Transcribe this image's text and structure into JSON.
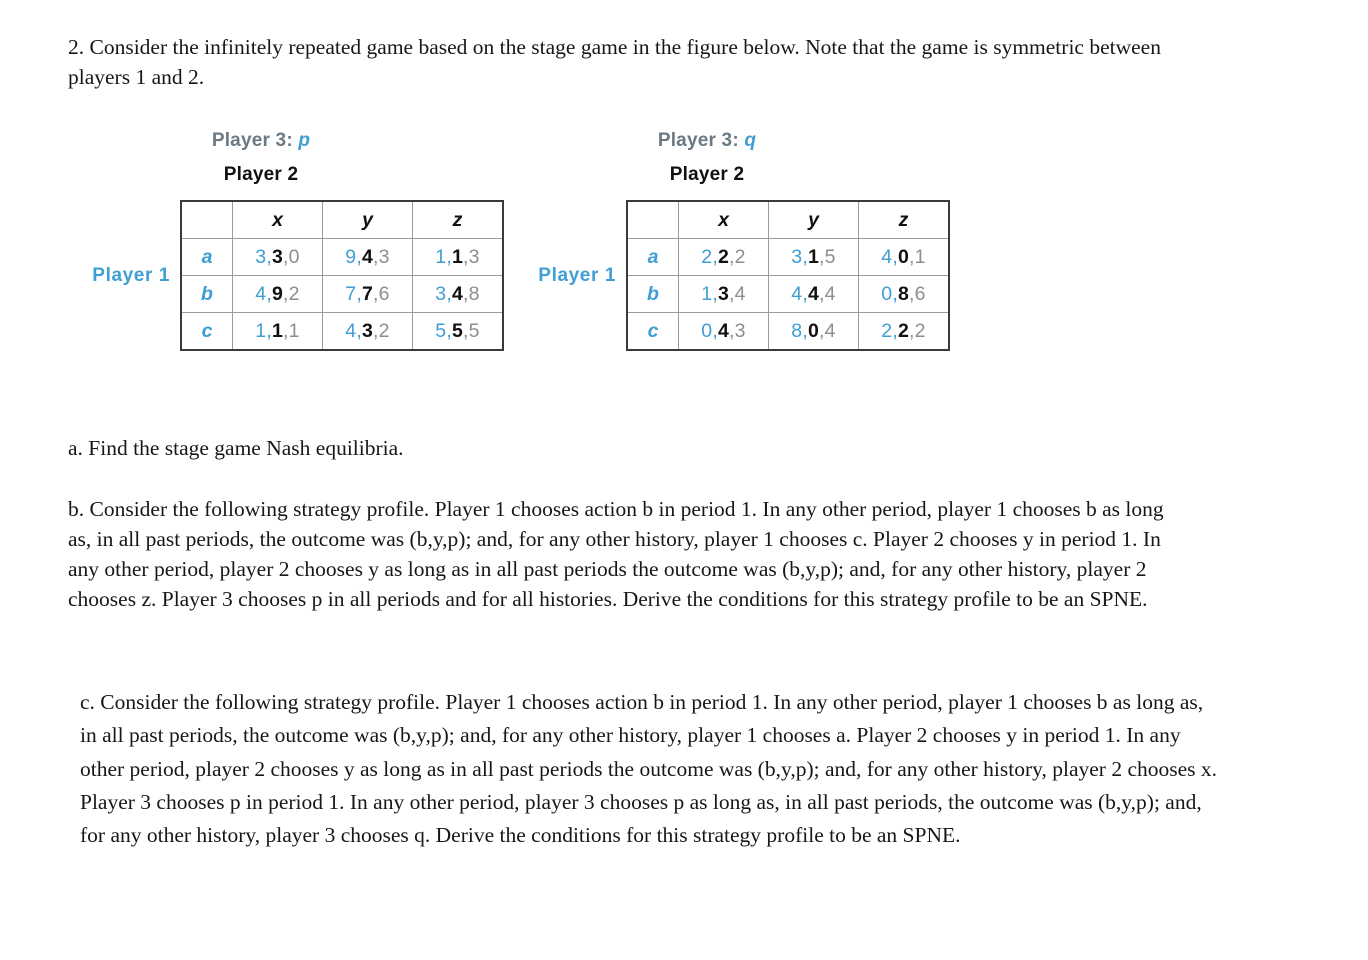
{
  "document": {
    "intro": "2. Consider the infinitely repeated game based on the stage game in the figure below. Note that the game is symmetric between players 1 and 2.",
    "part_a": "a. Find the stage game Nash equilibria.",
    "part_b": "b. Consider the following strategy profile. Player 1 chooses action b in period 1. In any other period, player 1 chooses b as long as, in all past periods, the outcome was (b,y,p); and, for any other history, player 1 chooses c. Player 2 chooses y in period 1. In any other period, player 2 chooses y as long as in all past periods the outcome was (b,y,p); and, for any other history, player 2 chooses z. Player 3 chooses p in all periods and for all histories. Derive the conditions for this strategy profile to be an SPNE.",
    "part_c": "c. Consider the following strategy profile. Player 1 chooses action b in period 1. In any other period, player 1 chooses b as long as, in all past periods, the outcome was (b,y,p); and, for any other history, player 1 chooses a. Player 2 chooses y in period 1. In any other period, player 2 chooses y as long as in all past periods the outcome was (b,y,p); and, for any other history, player 2 chooses x. Player 3 chooses p in period 1. In any other period, player 3 chooses p as long as, in all past periods, the outcome was (b,y,p); and, for any other history, player 3 chooses q. Derive the conditions for this strategy profile to be an SPNE."
  },
  "colors": {
    "player1": "#3f9fd4",
    "player2": "#111111",
    "player3": "#8d8d8d",
    "table_border": "#3a3a3a",
    "grid_line": "#9b9b9b"
  },
  "chart_data": {
    "type": "table",
    "title": "Stage game payoff matrices",
    "row_player_label": "Player 1",
    "column_player_label": "Player 2",
    "third_player_label": "Player 3",
    "row_actions": [
      "a",
      "b",
      "c"
    ],
    "column_actions": [
      "x",
      "y",
      "z"
    ],
    "third_player_actions": [
      "p",
      "q"
    ],
    "payoff_order": [
      "Player 1",
      "Player 2",
      "Player 3"
    ],
    "matrices": [
      {
        "id": "p",
        "header_prefix": "Player 3:",
        "header_action": "p",
        "column_header": "Player 2",
        "row_header": "Player 1",
        "columns": [
          "x",
          "y",
          "z"
        ],
        "rows": [
          {
            "label": "a",
            "cells": [
              {
                "text": "3,3,0",
                "u1": 3,
                "u2": 3,
                "u3": 0
              },
              {
                "text": "9,4,3",
                "u1": 9,
                "u2": 4,
                "u3": 3
              },
              {
                "text": "1,1,3",
                "u1": 1,
                "u2": 1,
                "u3": 3
              }
            ]
          },
          {
            "label": "b",
            "cells": [
              {
                "text": "4,9,2",
                "u1": 4,
                "u2": 9,
                "u3": 2
              },
              {
                "text": "7,7,6",
                "u1": 7,
                "u2": 7,
                "u3": 6
              },
              {
                "text": "3,4,8",
                "u1": 3,
                "u2": 4,
                "u3": 8
              }
            ]
          },
          {
            "label": "c",
            "cells": [
              {
                "text": "1,1,1",
                "u1": 1,
                "u2": 1,
                "u3": 1
              },
              {
                "text": "4,3,2",
                "u1": 4,
                "u2": 3,
                "u3": 2
              },
              {
                "text": "5,5,5",
                "u1": 5,
                "u2": 5,
                "u3": 5
              }
            ]
          }
        ]
      },
      {
        "id": "q",
        "header_prefix": "Player 3:",
        "header_action": "q",
        "column_header": "Player 2",
        "row_header": "Player 1",
        "columns": [
          "x",
          "y",
          "z"
        ],
        "rows": [
          {
            "label": "a",
            "cells": [
              {
                "text": "2,2,2",
                "u1": 2,
                "u2": 2,
                "u3": 2
              },
              {
                "text": "3,1,5",
                "u1": 3,
                "u2": 1,
                "u3": 5
              },
              {
                "text": "4,0,1",
                "u1": 4,
                "u2": 0,
                "u3": 1
              }
            ]
          },
          {
            "label": "b",
            "cells": [
              {
                "text": "1,3,4",
                "u1": 1,
                "u2": 3,
                "u3": 4
              },
              {
                "text": "4,4,4",
                "u1": 4,
                "u2": 4,
                "u3": 4
              },
              {
                "text": "0,8,6",
                "u1": 0,
                "u2": 8,
                "u3": 6
              }
            ]
          },
          {
            "label": "c",
            "cells": [
              {
                "text": "0,4,3",
                "u1": 0,
                "u2": 4,
                "u3": 3
              },
              {
                "text": "8,0,4",
                "u1": 8,
                "u2": 0,
                "u3": 4
              },
              {
                "text": "2,2,2",
                "u1": 2,
                "u2": 2,
                "u3": 2
              }
            ]
          }
        ]
      }
    ]
  }
}
